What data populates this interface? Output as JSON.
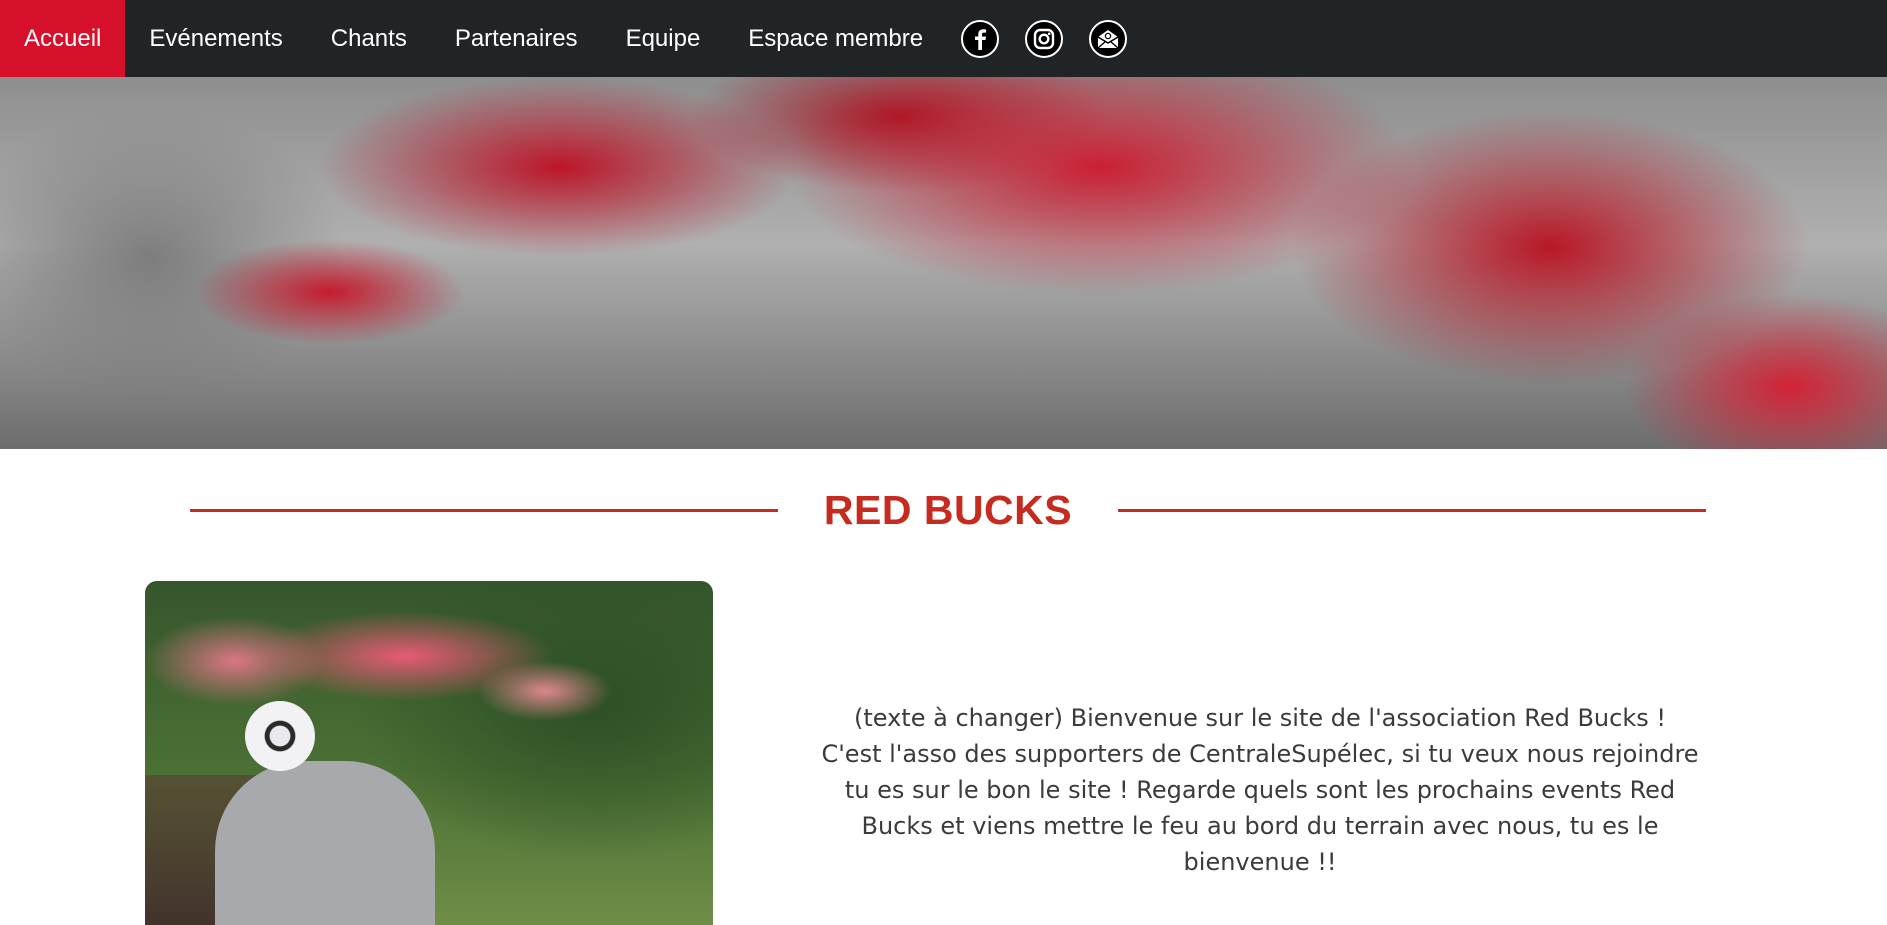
{
  "nav": {
    "items": [
      {
        "label": "Accueil",
        "active": true
      },
      {
        "label": "Evénements",
        "active": false
      },
      {
        "label": "Chants",
        "active": false
      },
      {
        "label": "Partenaires",
        "active": false
      },
      {
        "label": "Equipe",
        "active": false
      },
      {
        "label": "Espace membre",
        "active": false
      }
    ],
    "social": [
      "facebook-icon",
      "instagram-icon",
      "mail-icon"
    ]
  },
  "section": {
    "title": "RED BUCKS"
  },
  "intro": {
    "line1": "(texte à changer) Bienvenue sur le site de l'association Red Bucks !",
    "line2": "C'est l'asso des supporters de CentraleSupélec, si tu veux nous rejoindre tu es sur le bon le site ! Regarde quels sont les prochains events Red Bucks et viens mettre le feu au bord du terrain avec nous, tu es le bienvenue !!"
  },
  "colors": {
    "navbar_bg": "#212427",
    "active_nav": "#d6102a",
    "accent_red": "#c62b1f"
  }
}
